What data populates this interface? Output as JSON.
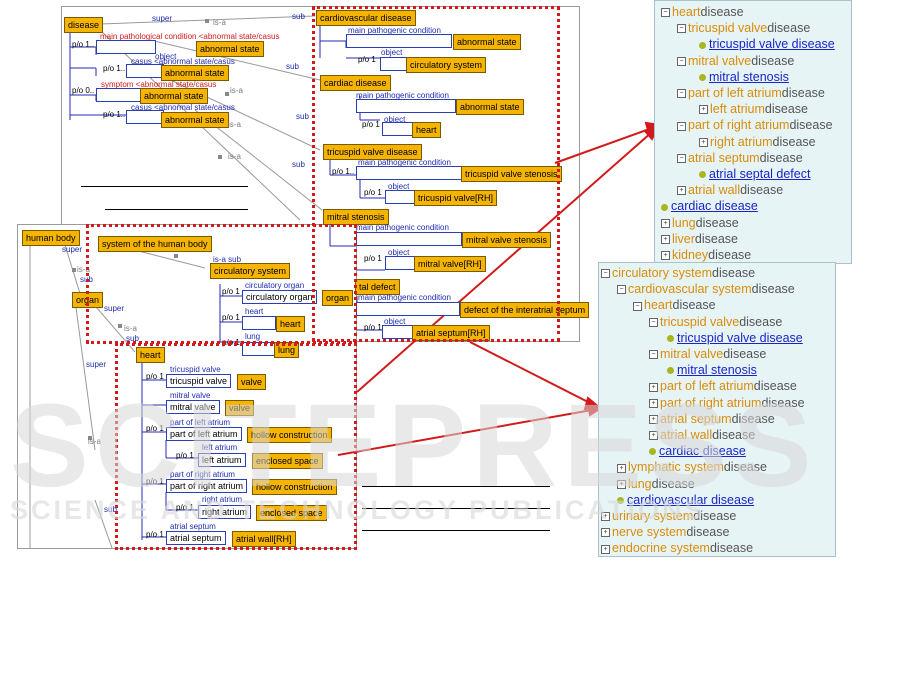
{
  "top_panel": {
    "disease": "disease",
    "super": "super",
    "isa1": "is-a",
    "sub1": "sub",
    "main_path_cond_casus": "main pathological condition <abnormal state/casus",
    "po1": "p/o 1..",
    "abnormal_state1": "abnormal state",
    "object1": "object",
    "po1b": "p/o 1..",
    "casus_abn1": "casus <abnormal state/casus",
    "abnormal_state2": "abnormal state",
    "sub2": "sub",
    "po0": "p/o 0..",
    "symptom": "symptom <abnormal state/casus",
    "abnormal_state3": "abnormal state",
    "po1c": "p/o 1..",
    "casus_abn2": "casus <abnormal state/casus",
    "abnormal_state4": "abnormal state",
    "isa2": "is-a",
    "isa3": "is-a",
    "sub3": "sub",
    "isa4": "is-a",
    "sub4": "sub",
    "cardiovascular_disease": "cardiovascular disease",
    "main_pathogenic_condition": "main pathogenic condition",
    "abnormal_state5": "abnormal state",
    "object2": "object",
    "po_a": "p/o 1",
    "circulatory_system": "circulatory system",
    "cardiac_disease": "cardiac disease",
    "main_pathogenic_condition2": "main pathogenic condition",
    "abnormal_state6": "abnormal state",
    "object3": "object",
    "po_b": "p/o 1",
    "heart": "heart",
    "tricuspid_valve_disease": "tricuspid valve disease",
    "main_pathogenic_condition3": "main pathogenic condition",
    "po_c": "p/o 1..",
    "tricuspid_valve_stenosis": "tricuspid valve stenosis",
    "object4": "object",
    "po_d": "p/o 1",
    "tricuspid_valve_rh": "tricuspid valve[RH]",
    "mitral_stenosis": "mitral stenosis",
    "main_pathogenic_condition4": "main pathogenic condition",
    "mitral_valve_stenosis": "mitral valve stenosis",
    "object5": "object",
    "po_e": "p/o 1",
    "mitral_valve_rh": "mitral valve[RH]",
    "atrial_defect": "tal defect",
    "main_pathogenic_condition5": "main pathogenic condition",
    "defect_interatrial": "defect of the interatrial septum",
    "object6": "object",
    "po_f": "p/o 1",
    "atrial_septum_rh": "atrial septum[RH]"
  },
  "bottom_panel": {
    "human_body": "human body",
    "super": "super",
    "isa1": "is-a",
    "sub1": "sub",
    "organ": "organ",
    "super2": "super",
    "isa2": "is-a",
    "sub2": "sub",
    "super3": "super",
    "isa3": "is-a",
    "sub3": "sub",
    "system_human_body": "system of the human body",
    "isa_sub": "is-a sub",
    "circulatory_system": "circulatory system",
    "po1": "p/o 1",
    "circ_organ_label": "circulatory organ",
    "circ_organ_box": "circulatory organ",
    "organ2": "organ",
    "po2": "p/o 1",
    "heart_label": "heart",
    "heart_box": "heart",
    "po3": "p/o 1",
    "lung_label": "lung",
    "lung_box": "lung",
    "heart_class": "heart",
    "tv_po": "p/o 1",
    "tv_label": "tricuspid valve",
    "tv_box": "tricuspid valve",
    "valve1": "valve",
    "mv_label": "mitral valve",
    "mv_box": "mitral valve",
    "valve2": "valve",
    "pla_po": "p/o 1",
    "pla_label": "part of left atrium",
    "pla_box": "part of left atrium",
    "hollow1": "hollow construction",
    "la_po": "p/o 1",
    "la_label": "left atrium",
    "la_box": "left atrium",
    "enclosed1": "enclosed space",
    "pra_po": "p/o 1",
    "pra_label": "part of right atrium",
    "pra_box": "part of right atrium",
    "hollow2": "hollow construction",
    "ra_po": "p/o 1",
    "ra_label": "right atrium",
    "ra_box": "right atrium",
    "enclosed2": "enclosed space",
    "as_po": "p/o 1",
    "as_label": "atrial septum",
    "as_box": "atrial septum",
    "atrial_wall_rh": "atrial wall[RH]"
  },
  "tree1": {
    "rows": [
      {
        "exp": "−",
        "o": "heart",
        "g": "disease"
      },
      {
        "exp": "−",
        "o": "tricuspid valve",
        "g": "disease"
      },
      {
        "link": "tricuspid valve disease"
      },
      {
        "exp": "−",
        "o": "mitral valve",
        "g": "disease"
      },
      {
        "link": "mitral stenosis"
      },
      {
        "exp": "−",
        "o": "part of left atrium",
        "g": "disease"
      },
      {
        "exp": "+",
        "o": "left atrium",
        "g": "disease"
      },
      {
        "exp": "−",
        "o": "part of right atrium",
        "g": "disease"
      },
      {
        "exp": "+",
        "o": "right atrium",
        "g": "disease"
      },
      {
        "exp": "−",
        "o": "atrial septum",
        "g": "disease"
      },
      {
        "link": "atrial septal defect"
      },
      {
        "exp": "+",
        "o": "atrial wall",
        "g": "disease"
      },
      {
        "link": "cardiac disease"
      },
      {
        "exp": "+",
        "o": "lung",
        "g": "disease"
      },
      {
        "exp": "+",
        "o": "liver",
        "g": "disease"
      },
      {
        "exp": "+",
        "o": "kidney",
        "g": "disease"
      }
    ]
  },
  "tree2": {
    "rows": [
      {
        "exp": "−",
        "o": "circulatory system",
        "g": "disease"
      },
      {
        "exp": "−",
        "o": "cardiovascular system",
        "g": "disease"
      },
      {
        "exp": "−",
        "o": "heart",
        "g": "disease"
      },
      {
        "exp": "−",
        "o": "tricuspid valve",
        "g": "disease"
      },
      {
        "link": "tricuspid valve disease"
      },
      {
        "exp": "−",
        "o": "mitral valve",
        "g": "disease"
      },
      {
        "link": "mitral stenosis"
      },
      {
        "exp": "+",
        "o": "part of left atrium",
        "g": "disease"
      },
      {
        "exp": "+",
        "o": "part of right atrium",
        "g": "disease"
      },
      {
        "exp": "+",
        "o": "atrial septum",
        "g": "disease"
      },
      {
        "exp": "+",
        "o": "atrial wall",
        "g": "disease"
      },
      {
        "link": "cardiac disease"
      },
      {
        "exp": "+",
        "o": "lymphatic system",
        "g": "disease"
      },
      {
        "exp": "+",
        "o": "lung",
        "g": "disease"
      },
      {
        "link": "cardiovascular disease"
      },
      {
        "exp": "+",
        "o": "urinary system",
        "g": "disease"
      },
      {
        "exp": "+",
        "o": "nerve system",
        "g": "disease"
      },
      {
        "exp": "+",
        "o": "endocrine system",
        "g": "disease"
      }
    ]
  },
  "watermark": {
    "big": "SCITEPRESS",
    "small": "SCIENCE AND TECHNOLOGY PUBLICATIONS"
  }
}
